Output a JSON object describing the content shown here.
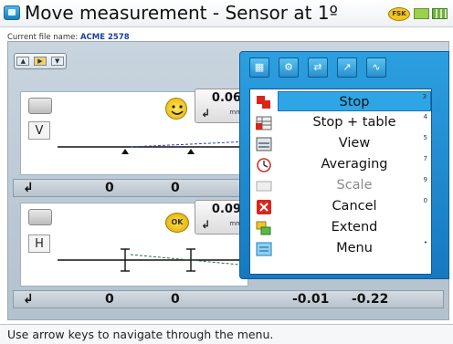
{
  "title": "Move measurement - Sensor at 1º",
  "status_icons": {
    "fsk": "FSK",
    "battery": "battery-icon",
    "plug": "plug-icon"
  },
  "file": {
    "label": "Current file name:",
    "name": "ACME 2578"
  },
  "tabs": [
    "▲",
    "▶",
    "▼"
  ],
  "vertical": {
    "letter": "V",
    "readout_value": "0.06",
    "readout_unit": "mm",
    "status_icon": "smiley-icon",
    "row": [
      "0",
      "0"
    ]
  },
  "horizontal": {
    "letter": "H",
    "readout_value": "0.09",
    "readout_unit": "mm",
    "status_badge": "OK",
    "row": [
      "0",
      "0",
      "-0.01",
      "-0.22"
    ]
  },
  "popup": {
    "toolbar": [
      "table-icon",
      "settings-icon",
      "flow-icon",
      "move-icon",
      "wave-icon"
    ],
    "menu": [
      {
        "label": "Stop",
        "num": "3",
        "selected": true,
        "dim": false
      },
      {
        "label": "Stop + table",
        "num": "4",
        "selected": false,
        "dim": false
      },
      {
        "label": "View",
        "num": "5",
        "selected": false,
        "dim": false
      },
      {
        "label": "Averaging",
        "num": "7",
        "selected": false,
        "dim": false
      },
      {
        "label": "Scale",
        "num": "9",
        "selected": false,
        "dim": true
      },
      {
        "label": "Cancel",
        "num": "0",
        "selected": false,
        "dim": false
      },
      {
        "label": "Extend",
        "num": "",
        "selected": false,
        "dim": false
      },
      {
        "label": "Menu",
        "num": "•",
        "selected": false,
        "dim": false
      }
    ]
  },
  "statusbar": "Use arrow keys to navigate through the menu.",
  "colors": {
    "accent": "#2ea6e6",
    "panel": "#1679c0"
  }
}
